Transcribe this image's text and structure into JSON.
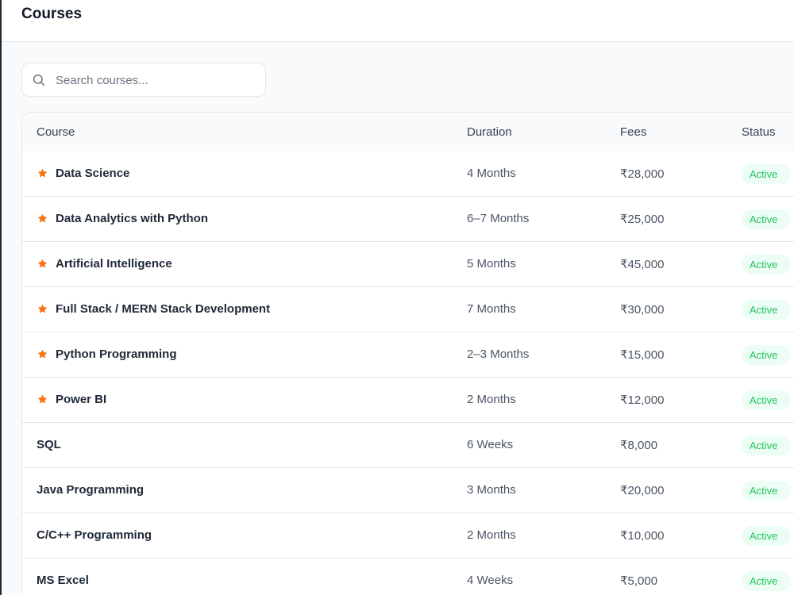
{
  "header": {
    "title": "Courses"
  },
  "search": {
    "placeholder": "Search courses..."
  },
  "table": {
    "headers": {
      "course": "Course",
      "duration": "Duration",
      "fees": "Fees",
      "status": "Status"
    },
    "rows": [
      {
        "name": "Data Science",
        "duration": "4 Months",
        "fees": "₹28,000",
        "status": "Active",
        "featured": true
      },
      {
        "name": "Data Analytics with Python",
        "duration": "6–7 Months",
        "fees": "₹25,000",
        "status": "Active",
        "featured": true
      },
      {
        "name": "Artificial Intelligence",
        "duration": "5 Months",
        "fees": "₹45,000",
        "status": "Active",
        "featured": true
      },
      {
        "name": "Full Stack / MERN Stack Development",
        "duration": "7 Months",
        "fees": "₹30,000",
        "status": "Active",
        "featured": true
      },
      {
        "name": "Python Programming",
        "duration": "2–3 Months",
        "fees": "₹15,000",
        "status": "Active",
        "featured": true
      },
      {
        "name": "Power BI",
        "duration": "2 Months",
        "fees": "₹12,000",
        "status": "Active",
        "featured": true
      },
      {
        "name": "SQL",
        "duration": "6 Weeks",
        "fees": "₹8,000",
        "status": "Active",
        "featured": false
      },
      {
        "name": "Java Programming",
        "duration": "3 Months",
        "fees": "₹20,000",
        "status": "Active",
        "featured": false
      },
      {
        "name": "C/C++ Programming",
        "duration": "2 Months",
        "fees": "₹10,000",
        "status": "Active",
        "featured": false
      },
      {
        "name": "MS Excel",
        "duration": "4 Weeks",
        "fees": "₹5,000",
        "status": "Active",
        "featured": false
      }
    ]
  },
  "icons": {
    "search": "search-icon",
    "featured": "star-icon"
  },
  "colors": {
    "featured_star": "#f97316",
    "active_text": "#22c55e",
    "active_bg": "#ecfdf5",
    "border": "#e5e7eb"
  }
}
